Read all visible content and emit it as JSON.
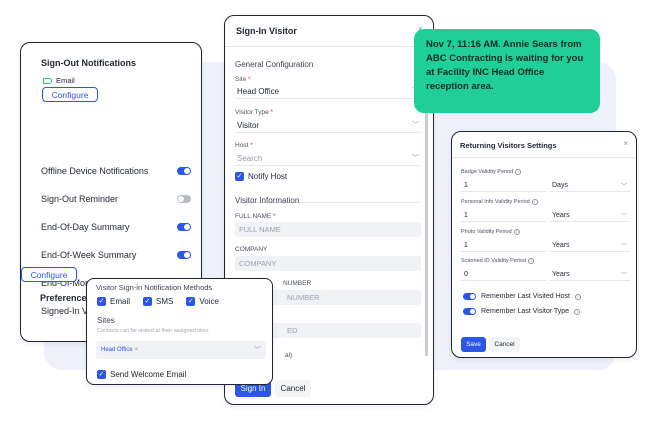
{
  "notifications": {
    "title": "Sign-Out Notifications",
    "email_label": "Email",
    "configure_label": "Configure",
    "rows": [
      {
        "label": "Offline Device Notifications",
        "on": true
      },
      {
        "label": "Sign-Out Reminder",
        "on": false
      },
      {
        "label": "End-Of-Day Summary",
        "on": true
      },
      {
        "label": "End-Of-Week Summary",
        "on": true
      },
      {
        "label": "End-Of-Month Summary",
        "on": true
      },
      {
        "label": "Signed-In Visitors Report",
        "on": true
      }
    ],
    "preferences_label": "Preferences",
    "configure2_label": "Configure"
  },
  "signin": {
    "title": "Sign-In Visitor",
    "close": "×",
    "general_config": "General Configuration",
    "site_label": "Site",
    "site_value": "Head Office",
    "visitor_type_label": "Visitor Type",
    "visitor_type_value": "Visitor",
    "host_label": "Host",
    "host_placeholder": "Search",
    "notify_host": "Notify Host",
    "visitor_info": "Visitor Information",
    "full_name_label": "FULL NAME",
    "full_name_placeholder": "FULL NAME",
    "company_label": "COMPANY",
    "company_placeholder": "COMPANY",
    "phone_label_partial": "NUMBER",
    "phone_placeholder_partial": "NUMBER",
    "field4_partial": "ED",
    "field5_partial": "al)",
    "signin_button": "Sign In",
    "cancel_button": "Cancel",
    "required": "*"
  },
  "toast": {
    "message": "Nov 7, 11:16 AM. Annie Sears from ABC Contracting is waiting for you at Facility INC Head Office reception area."
  },
  "returning": {
    "title": "Returning Visitors Settings",
    "close": "×",
    "rows": [
      {
        "label": "Badge Validity Period",
        "value": "1",
        "unit": "Days"
      },
      {
        "label": "Personal Info Validity Period",
        "value": "1",
        "unit": "Years"
      },
      {
        "label": "Photo Validity Period",
        "value": "1",
        "unit": "Years"
      },
      {
        "label": "Scanned ID Validity Period",
        "value": "0",
        "unit": "Years"
      }
    ],
    "remember_host": "Remember Last Visited Host",
    "remember_type": "Remember Last Visitor Type",
    "save_button": "Save",
    "cancel_button": "Cancel"
  },
  "methods": {
    "title": "Visitor Sign-in Notification Methods",
    "email": "Email",
    "sms": "SMS",
    "voice": "Voice",
    "sites_label": "Sites",
    "sites_sub": "Contacts can be visited at their assigned sites",
    "site_chip": "Head Office",
    "chip_remove": "×",
    "send_welcome": "Send Welcome Email"
  },
  "colors": {
    "accent": "#2d55e6",
    "toast": "#1fcf96",
    "backdrop": "#eef1fb"
  },
  "icons": {
    "check": "✓",
    "chevron": "﹀",
    "info": "i"
  }
}
